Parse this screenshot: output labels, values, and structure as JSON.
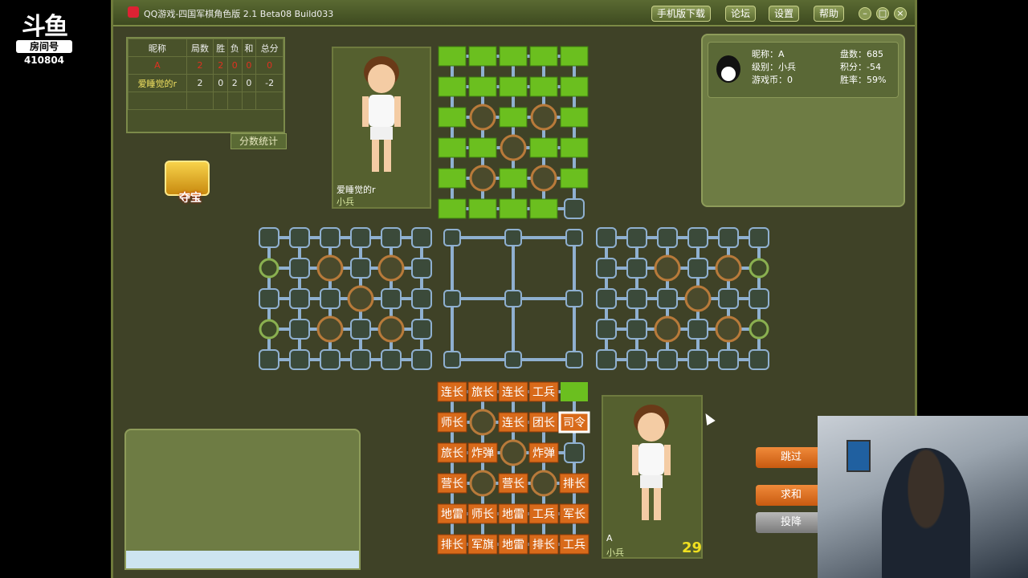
{
  "stream": {
    "logo": "斗鱼",
    "room_label": "房间号",
    "room_number": "410804"
  },
  "window": {
    "title": "QQ游戏-四国军棋角色版 2.1 Beta08 Build033",
    "buttons": [
      "手机版下载",
      "论坛",
      "设置",
      "帮助"
    ],
    "controls": [
      "help-icon",
      "maximize-icon",
      "close-icon"
    ]
  },
  "scoreboard": {
    "headers": [
      "昵称",
      "局数",
      "胜",
      "负",
      "和",
      "总分"
    ],
    "rows": [
      {
        "name": "A",
        "games": "2",
        "win": "2",
        "lose": "0",
        "draw": "0",
        "total": "0"
      },
      {
        "name": "爱睡觉的r",
        "games": "2",
        "win": "0",
        "lose": "2",
        "draw": "0",
        "total": "-2"
      }
    ],
    "stats_button": "分数统计"
  },
  "treasure": {
    "label": "夺宝"
  },
  "opponent": {
    "name": "爱睡觉的r",
    "rank": "小兵"
  },
  "self": {
    "name": "A",
    "rank": "小兵",
    "timer": "29"
  },
  "info": {
    "nickname": "昵称：A",
    "level": "级别：小兵",
    "coins": "游戏币：0",
    "games": "盘数：685",
    "points": "积分：-54",
    "winrate": "胜率：59%"
  },
  "actions": {
    "skip": "跳过",
    "draw": "求和",
    "surrender": "投降"
  },
  "colors": {
    "green_piece": "#6bbf1f",
    "orange_piece": "#d86a1a",
    "rail": "#8fb0d0",
    "circle": "#b87a3a"
  },
  "my_pieces": [
    [
      "连长",
      "旅长",
      "连长",
      "工兵",
      ""
    ],
    [
      "师长",
      null,
      "连长",
      "团长",
      "司令"
    ],
    [
      "旅长",
      "炸弹",
      null,
      "炸弹",
      ""
    ],
    [
      "营长",
      null,
      "营长",
      null,
      "排长"
    ],
    [
      "地雷",
      "师长",
      "地雷",
      "工兵",
      "军长"
    ],
    [
      "排长",
      "军旗",
      "地雷",
      "排长",
      "工兵"
    ]
  ]
}
